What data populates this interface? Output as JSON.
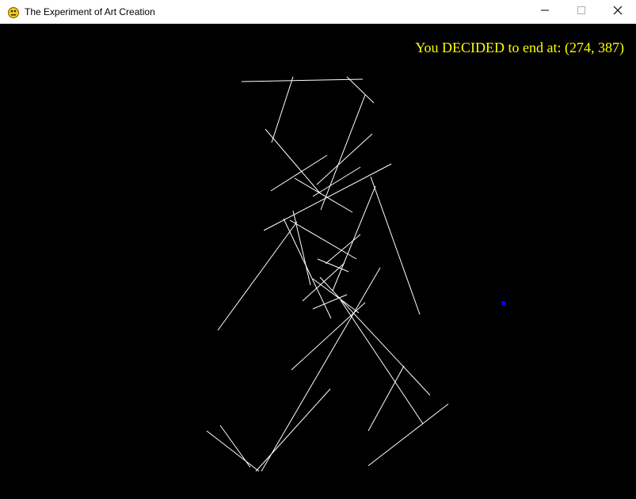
{
  "window": {
    "title": "The Experiment of Art Creation",
    "app_icon": "pygame-snake-icon",
    "controls": {
      "minimize": "minimize-icon",
      "maximize": "maximize-icon",
      "close": "close-icon"
    }
  },
  "canvas": {
    "background_color": "#000000",
    "line_color": "#ffffff",
    "marker_color": "#0000ff",
    "status_color": "#ffff00",
    "status_text": "You DECIDED to end at: (274, 387)"
  }
}
